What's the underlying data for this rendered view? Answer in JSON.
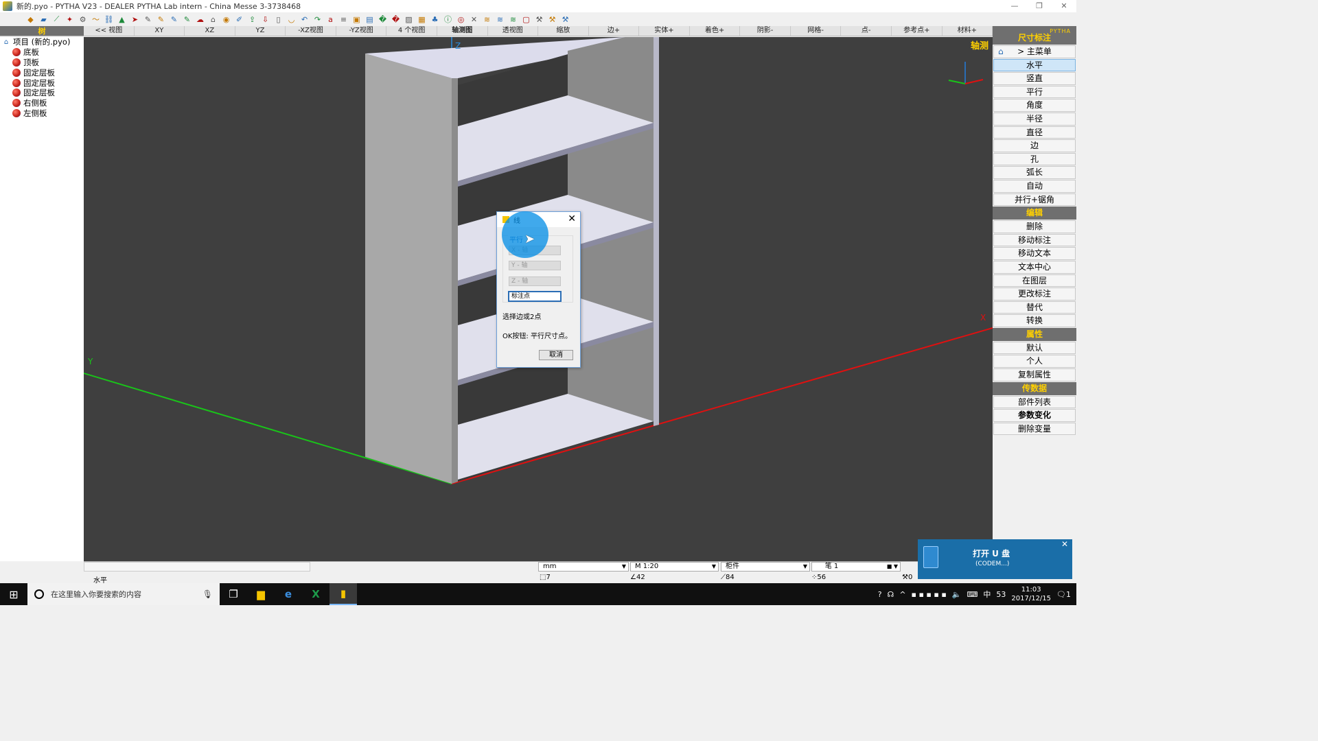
{
  "window": {
    "title": "新的.pyo - PYTHA V23 - DEALER PYTHA Lab intern - China Messe    3-3738468",
    "controls": [
      "—",
      "❐",
      "✕"
    ]
  },
  "toolbar_icons": [
    "cube-icon",
    "folder-icon",
    "line-icon",
    "star-icon",
    "gear-icon",
    "curve-icon",
    "link-icon",
    "paint-icon",
    "arrow-icon",
    "brush-icon",
    "brush2-icon",
    "brush3-icon",
    "brush4-icon",
    "cloud-icon",
    "mouse-icon",
    "eye-icon",
    "pen-icon",
    "export-icon",
    "import-icon",
    "cylinder-icon",
    "cup-icon",
    "undo-icon",
    "redo-icon",
    "attr-icon",
    "list-icon",
    "100-icon",
    "table-icon",
    "book-icon",
    "hatch-icon",
    "layer-icon",
    "tree-icon",
    "info-icon",
    "globe-icon",
    "cross-icon",
    "stack-icon",
    "stack2-icon",
    "stack3-icon",
    "box-icon",
    "tool-icon",
    "tool2-icon",
    "tool3-icon",
    "scissors-icon"
  ],
  "tree": {
    "header": "树",
    "root": "项目 (新的.pyo)",
    "items": [
      "底板",
      "顶板",
      "固定层板",
      "固定层板",
      "固定层板",
      "右侧板",
      "左侧板"
    ]
  },
  "viewtabs": [
    "<< 视图",
    "XY",
    "XZ",
    "YZ",
    "-XZ视图",
    "-YZ视图",
    "4 个视图",
    "轴测图",
    "透视图",
    "缩放",
    "边+",
    "实体+",
    "着色+",
    "阴影-",
    "网格-",
    "点-",
    "参考点+",
    "材料+"
  ],
  "viewport": {
    "label": "轴测",
    "axis_x": "X",
    "axis_y": "Y",
    "axis_z": "Z"
  },
  "right_panel": {
    "logo": "PYTHA",
    "header": "尺寸标注",
    "main_menu": "> 主菜单",
    "dim_buttons": [
      "水平",
      "竖直",
      "平行",
      "角度",
      "半径",
      "直径",
      "边",
      "孔",
      "弧长",
      "自动",
      "并行+锯角"
    ],
    "edit_header": "编辑",
    "edit_buttons": [
      "删除",
      "移动标注",
      "移动文本",
      "文本中心",
      "在图层",
      "更改标注",
      "替代",
      "转换"
    ],
    "attr_header": "属性",
    "attr_buttons": [
      "默认",
      "个人",
      "复制属性"
    ],
    "data_header": "传数据",
    "data_buttons": [
      "部件列表",
      "参数变化",
      "删除变量"
    ]
  },
  "dialog": {
    "title": "线",
    "group_label": "平行",
    "x_axis": "X - 轴",
    "y_axis": "Y - 轴",
    "z_axis": "Z - 轴",
    "point": "标注点",
    "instruction": "选择边或2点",
    "ok_hint": "OK按钮: 平行尺寸点。",
    "cancel": "取消"
  },
  "status": {
    "command": "水平",
    "unit": "mm",
    "scale": "M 1:20",
    "mode": "柜件",
    "layer": "    笔 1",
    "count_a": "7",
    "count_b": "42",
    "count_c": "84",
    "count_d": "56",
    "count_e": "0"
  },
  "toast": {
    "title": "打开 U 盘",
    "subtitle": "(CODEM...)",
    "close": "✕"
  },
  "taskbar": {
    "search_placeholder": "在这里输入你要搜索的内容",
    "time": "11:03",
    "date": "2017/12/15",
    "ime": "中",
    "badge": "53",
    "notif": "1"
  }
}
